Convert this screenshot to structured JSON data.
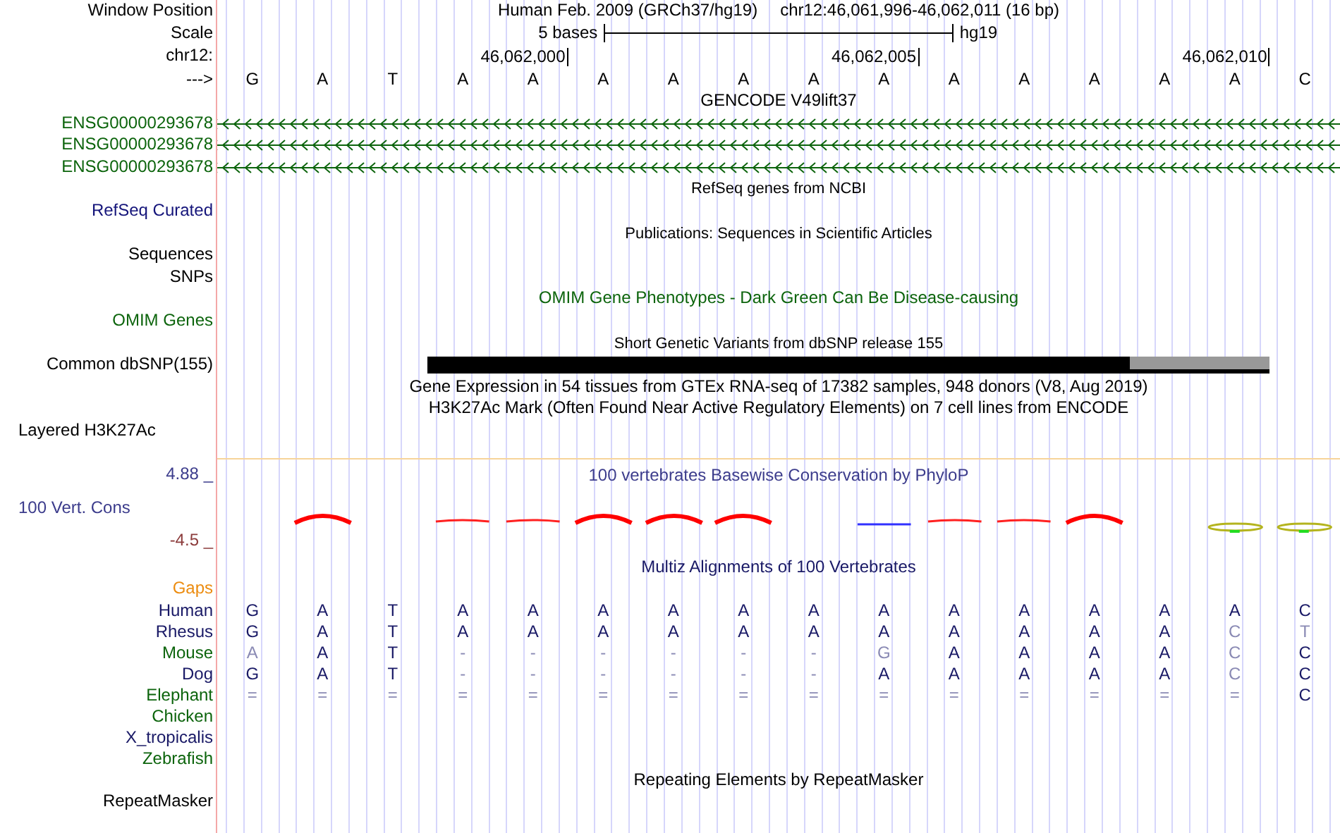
{
  "rows": [
    {
      "kind": "position",
      "label": "Window Position",
      "assembly": "Human Feb. 2009 (GRCh37/hg19)",
      "position": "chr12:46,061,996-46,062,011 (16 bp)"
    },
    {
      "kind": "scale",
      "label": "Scale",
      "length": "5 bases",
      "assembly": "hg19"
    },
    {
      "kind": "ruler",
      "label": "chr12:"
    },
    {
      "kind": "bases",
      "label": "--->",
      "bases": [
        {
          "base": "G"
        },
        {
          "base": "A"
        },
        {
          "base": "T"
        },
        {
          "base": "A"
        },
        {
          "base": "A",
          "tick": "46,062,000"
        },
        {
          "base": "A"
        },
        {
          "base": "A"
        },
        {
          "base": "A"
        },
        {
          "base": "A"
        },
        {
          "base": "A",
          "tick": "46,062,005"
        },
        {
          "base": "A"
        },
        {
          "base": "A"
        },
        {
          "base": "A"
        },
        {
          "base": "A"
        },
        {
          "base": "A",
          "tick": "46,062,010"
        },
        {
          "base": "C"
        }
      ]
    },
    {
      "kind": "title",
      "text": "GENCODE V49lift37",
      "small": false,
      "color": "#000000"
    },
    {
      "kind": "gene",
      "label": "ENSG00000293678",
      "color": "#0c640c"
    },
    {
      "kind": "gene",
      "label": "ENSG00000293678",
      "color": "#0c640c"
    },
    {
      "kind": "gene",
      "label": "ENSG00000293678",
      "color": "#0c640c"
    },
    {
      "kind": "title",
      "text": "RefSeq genes from NCBI",
      "small": true,
      "color": "#000000"
    },
    {
      "kind": "label",
      "label": "RefSeq Curated",
      "color": "#14147a"
    },
    {
      "kind": "title",
      "text": "Publications: Sequences in Scientific Articles",
      "small": true,
      "color": "#000000"
    },
    {
      "kind": "label",
      "label": "Sequences",
      "color": "#000000"
    },
    {
      "kind": "label",
      "label": "SNPs",
      "color": "#000000"
    },
    {
      "kind": "title",
      "text": "OMIM Gene Phenotypes - Dark Green Can Be Disease-causing",
      "small": false,
      "color": "#0c640c"
    },
    {
      "kind": "label",
      "label": "OMIM Genes",
      "color": "#0c640c"
    },
    {
      "kind": "title",
      "text": "Short Genetic Variants from dbSNP release 155",
      "small": true,
      "color": "#000000"
    },
    {
      "kind": "variant",
      "label": "Common dbSNP(155)",
      "coverage": [
        {
          "covered": false
        },
        {
          "covered": false
        },
        {
          "covered": false
        },
        {
          "covered": true,
          "light": false
        },
        {
          "covered": true,
          "light": false
        },
        {
          "covered": true,
          "light": false
        },
        {
          "covered": true,
          "light": false
        },
        {
          "covered": true,
          "light": false
        },
        {
          "covered": true,
          "light": false
        },
        {
          "covered": true,
          "light": false
        },
        {
          "covered": true,
          "light": false
        },
        {
          "covered": true,
          "light": false
        },
        {
          "covered": true,
          "light": false
        },
        {
          "covered": true,
          "light": true
        },
        {
          "covered": true,
          "light": true
        },
        {
          "covered": false
        }
      ]
    },
    {
      "kind": "title",
      "text": "Gene Expression in 54 tissues from GTEx RNA-seq of 17382 samples, 948 donors (V8, Aug 2019)",
      "small": false,
      "color": "#000000"
    },
    {
      "kind": "title",
      "text": "H3K27Ac Mark (Often Found Near Active Regulatory Elements) on 7 cell lines from ENCODE",
      "small": false,
      "color": "#000000"
    },
    {
      "kind": "label",
      "label": "Layered H3K27Ac",
      "color": "#000000",
      "align_left": true
    },
    {
      "kind": "wiggle",
      "label": "100 Vert. Cons",
      "title": "100 vertebrates Basewise Conservation by PhyloP",
      "max": "4.88 _",
      "min": "-4.5 _",
      "marks": [
        {
          "kind": "none"
        },
        {
          "kind": "peak"
        },
        {
          "kind": "none"
        },
        {
          "kind": "flat"
        },
        {
          "kind": "flat"
        },
        {
          "kind": "peak"
        },
        {
          "kind": "peak"
        },
        {
          "kind": "peak"
        },
        {
          "kind": "none"
        },
        {
          "kind": "flat_blue"
        },
        {
          "kind": "flat"
        },
        {
          "kind": "flat"
        },
        {
          "kind": "peak"
        },
        {
          "kind": "none"
        },
        {
          "kind": "loop"
        },
        {
          "kind": "loop"
        }
      ]
    },
    {
      "kind": "title",
      "text": "Multiz Alignments of 100 Vertebrates",
      "small": false,
      "color": "#191966"
    },
    {
      "kind": "label",
      "label": "Gaps",
      "color": "#ec8c10"
    },
    {
      "kind": "species",
      "label": "Human",
      "color": "#191966",
      "bases": [
        {
          "base": "G",
          "faded": false
        },
        {
          "base": "A",
          "faded": false
        },
        {
          "base": "T",
          "faded": false
        },
        {
          "base": "A",
          "faded": false
        },
        {
          "base": "A",
          "faded": false
        },
        {
          "base": "A",
          "faded": false
        },
        {
          "base": "A",
          "faded": false
        },
        {
          "base": "A",
          "faded": false
        },
        {
          "base": "A",
          "faded": false
        },
        {
          "base": "A",
          "faded": false
        },
        {
          "base": "A",
          "faded": false
        },
        {
          "base": "A",
          "faded": false
        },
        {
          "base": "A",
          "faded": false
        },
        {
          "base": "A",
          "faded": false
        },
        {
          "base": "A",
          "faded": false
        },
        {
          "base": "C",
          "faded": false
        }
      ]
    },
    {
      "kind": "species",
      "label": "Rhesus",
      "color": "#191966",
      "bases": [
        {
          "base": "G",
          "faded": false
        },
        {
          "base": "A",
          "faded": false
        },
        {
          "base": "T",
          "faded": false
        },
        {
          "base": "A",
          "faded": false
        },
        {
          "base": "A",
          "faded": false
        },
        {
          "base": "A",
          "faded": false
        },
        {
          "base": "A",
          "faded": false
        },
        {
          "base": "A",
          "faded": false
        },
        {
          "base": "A",
          "faded": false
        },
        {
          "base": "A",
          "faded": false
        },
        {
          "base": "A",
          "faded": false
        },
        {
          "base": "A",
          "faded": false
        },
        {
          "base": "A",
          "faded": false
        },
        {
          "base": "A",
          "faded": false
        },
        {
          "base": "C",
          "faded": true
        },
        {
          "base": "T",
          "faded": true
        }
      ]
    },
    {
      "kind": "species",
      "label": "Mouse",
      "color": "#0c640c",
      "bases": [
        {
          "base": "A",
          "faded": true
        },
        {
          "base": "A",
          "faded": false
        },
        {
          "base": "T",
          "faded": false
        },
        {
          "base": "-",
          "faded": true
        },
        {
          "base": "-",
          "faded": true
        },
        {
          "base": "-",
          "faded": true
        },
        {
          "base": "-",
          "faded": true
        },
        {
          "base": "-",
          "faded": true
        },
        {
          "base": "-",
          "faded": true
        },
        {
          "base": "G",
          "faded": true
        },
        {
          "base": "A",
          "faded": false
        },
        {
          "base": "A",
          "faded": false
        },
        {
          "base": "A",
          "faded": false
        },
        {
          "base": "A",
          "faded": false
        },
        {
          "base": "C",
          "faded": true
        },
        {
          "base": "C",
          "faded": false
        }
      ]
    },
    {
      "kind": "species",
      "label": "Dog",
      "color": "#191966",
      "bases": [
        {
          "base": "G",
          "faded": false
        },
        {
          "base": "A",
          "faded": false
        },
        {
          "base": "T",
          "faded": false
        },
        {
          "base": "-",
          "faded": true
        },
        {
          "base": "-",
          "faded": true
        },
        {
          "base": "-",
          "faded": true
        },
        {
          "base": "-",
          "faded": true
        },
        {
          "base": "-",
          "faded": true
        },
        {
          "base": "-",
          "faded": true
        },
        {
          "base": "A",
          "faded": false
        },
        {
          "base": "A",
          "faded": false
        },
        {
          "base": "A",
          "faded": false
        },
        {
          "base": "A",
          "faded": false
        },
        {
          "base": "A",
          "faded": false
        },
        {
          "base": "C",
          "faded": true
        },
        {
          "base": "C",
          "faded": false
        }
      ]
    },
    {
      "kind": "species",
      "label": "Elephant",
      "color": "#0c640c",
      "bases": [
        {
          "base": "=",
          "faded": true
        },
        {
          "base": "=",
          "faded": true
        },
        {
          "base": "=",
          "faded": true
        },
        {
          "base": "=",
          "faded": true
        },
        {
          "base": "=",
          "faded": true
        },
        {
          "base": "=",
          "faded": true
        },
        {
          "base": "=",
          "faded": true
        },
        {
          "base": "=",
          "faded": true
        },
        {
          "base": "=",
          "faded": true
        },
        {
          "base": "=",
          "faded": true
        },
        {
          "base": "=",
          "faded": true
        },
        {
          "base": "=",
          "faded": true
        },
        {
          "base": "=",
          "faded": true
        },
        {
          "base": "=",
          "faded": true
        },
        {
          "base": "=",
          "faded": true
        },
        {
          "base": "C",
          "faded": false
        }
      ]
    },
    {
      "kind": "species",
      "label": "Chicken",
      "color": "#0c640c"
    },
    {
      "kind": "species",
      "label": "X_tropicalis",
      "color": "#191966"
    },
    {
      "kind": "species",
      "label": "Zebrafish",
      "color": "#0c640c"
    },
    {
      "kind": "title",
      "text": "Repeating Elements by RepeatMasker",
      "small": false,
      "color": "#000000"
    },
    {
      "kind": "label",
      "label": "RepeatMasker",
      "color": "#000000"
    }
  ]
}
